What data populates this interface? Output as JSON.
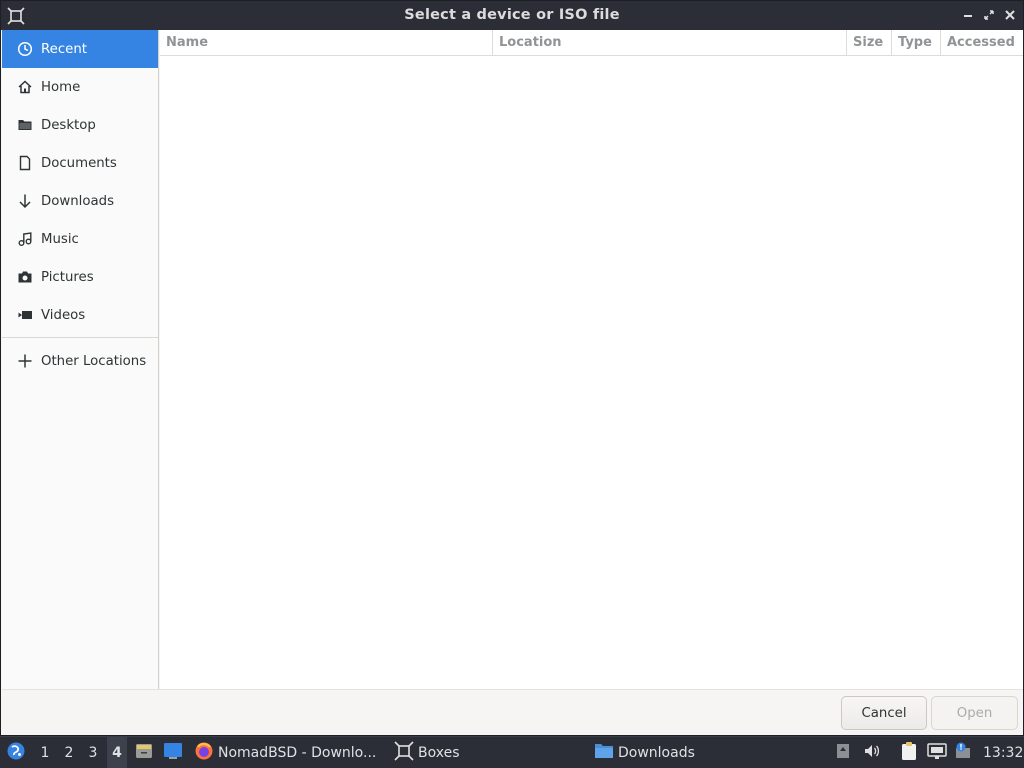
{
  "window": {
    "title": "Select a device or ISO file"
  },
  "sidebar": {
    "items": [
      {
        "label": "Recent",
        "icon": "recent-icon"
      },
      {
        "label": "Home",
        "icon": "home-icon"
      },
      {
        "label": "Desktop",
        "icon": "folder-icon"
      },
      {
        "label": "Documents",
        "icon": "document-icon"
      },
      {
        "label": "Downloads",
        "icon": "download-arrow-icon"
      },
      {
        "label": "Music",
        "icon": "music-icon"
      },
      {
        "label": "Pictures",
        "icon": "camera-icon"
      },
      {
        "label": "Videos",
        "icon": "video-icon"
      }
    ],
    "other_locations": "Other Locations",
    "active": "Recent"
  },
  "filelist": {
    "columns": [
      "Name",
      "Location",
      "Size",
      "Type",
      "Accessed"
    ],
    "rows": []
  },
  "actions": {
    "cancel": "Cancel",
    "open": "Open"
  },
  "taskbar": {
    "workspaces": [
      "1",
      "2",
      "3",
      "4"
    ],
    "current_workspace": "4",
    "tasks": [
      {
        "label": "NomadBSD - Downlo...",
        "icon": "firefox-icon"
      },
      {
        "label": "Boxes",
        "icon": "boxes-icon"
      },
      {
        "label": "Downloads",
        "icon": "folder-icon"
      }
    ],
    "clock": "13:32"
  },
  "colors": {
    "accent": "#3584e4",
    "titlebar": "#2b2e37",
    "taskbar": "#2b2e37"
  }
}
